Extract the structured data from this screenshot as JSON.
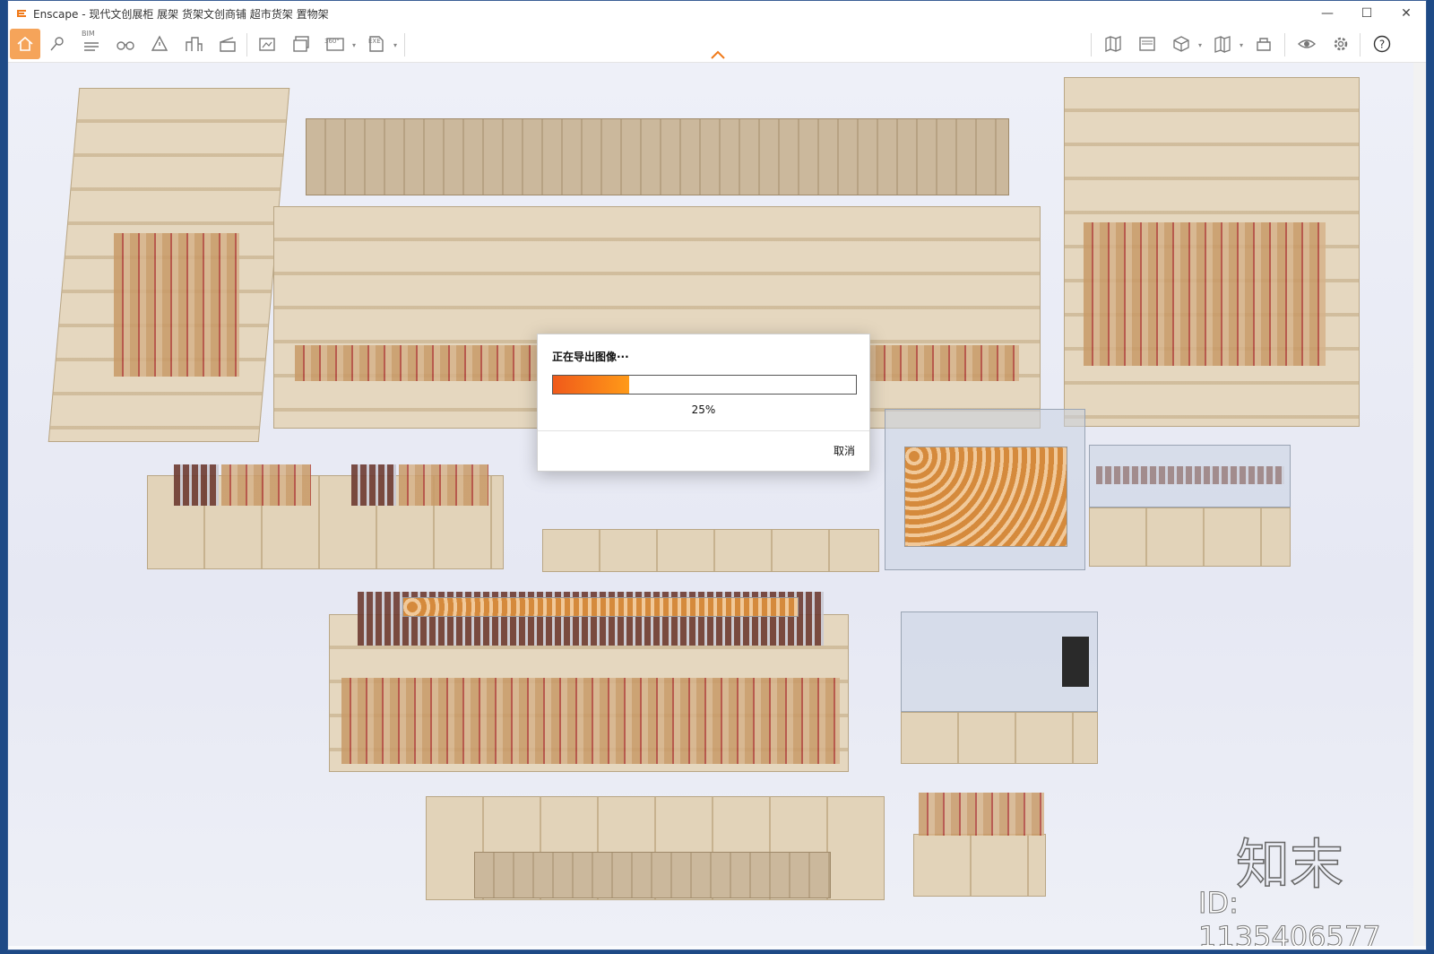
{
  "window": {
    "app_name": "Enscape",
    "title": "Enscape - 现代文创展柜 展架 货架文创商铺 超市货架 置物架",
    "controls": {
      "minimize": "—",
      "maximize": "☐",
      "close": "✕"
    }
  },
  "toolbar": {
    "bim_label": "BIM",
    "panorama_label": "360°",
    "exe_label": "EXE",
    "left_icons": [
      "home-icon",
      "pin-icon",
      "bim-icon",
      "binoculars-icon",
      "warning-icon",
      "buildings-icon",
      "clapper-icon",
      "screenshot-icon",
      "batch-render-icon",
      "panorama-icon",
      "export-exe-icon"
    ],
    "right_icons": [
      "map-icon",
      "image-gallery-icon",
      "cube-icon",
      "book-icon",
      "asset-library-icon",
      "visual-settings-icon",
      "settings-icon",
      "help-icon"
    ]
  },
  "dialog": {
    "title": "正在导出图像···",
    "progress": 0.25,
    "percent_label": "25%",
    "cancel_label": "取消"
  },
  "watermark": {
    "logo": "知末",
    "id": "ID: 1135406577"
  },
  "colors": {
    "accent": "#f5a45a",
    "progress_start": "#f05a1a",
    "progress_end": "#ff9a18"
  }
}
